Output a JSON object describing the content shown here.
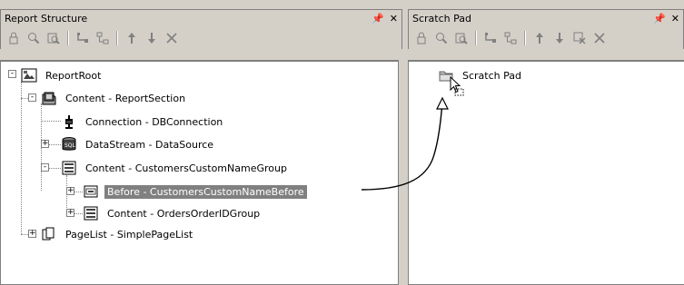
{
  "left_panel": {
    "title": "Report Structure",
    "pin": "†",
    "close": "✕",
    "toolbar": [
      "lock-icon",
      "find-icon",
      "find-replace-icon",
      "indent-icon",
      "outdent-icon",
      "move-up-icon",
      "move-down-icon",
      "delete-icon"
    ],
    "tree": [
      {
        "label": "ReportRoot",
        "expander": "-",
        "icon": "report-root-icon"
      },
      {
        "label": "Content - ReportSection",
        "expander": "-",
        "icon": "section-icon"
      },
      {
        "label": "Connection - DBConnection",
        "expander": "",
        "icon": "connection-icon"
      },
      {
        "label": "DataStream - DataSource",
        "expander": "+",
        "icon": "datasource-icon"
      },
      {
        "label": "Content - CustomersCustomNameGroup",
        "expander": "-",
        "icon": "group-icon"
      },
      {
        "label": "Before - CustomersCustomNameBefore",
        "expander": "+",
        "icon": "band-icon",
        "selected": true
      },
      {
        "label": "Content - OrdersOrderIDGroup",
        "expander": "+",
        "icon": "group-icon"
      },
      {
        "label": "PageList - SimplePageList",
        "expander": "+",
        "icon": "pagelist-icon"
      }
    ]
  },
  "right_panel": {
    "title": "Scratch Pad",
    "pin": "†",
    "close": "✕",
    "toolbar": [
      "lock-icon",
      "find-icon",
      "find-replace-icon",
      "indent-icon",
      "outdent-icon",
      "move-up-icon",
      "move-down-icon",
      "cut-icon",
      "delete-icon"
    ],
    "tree": [
      {
        "label": "Scratch Pad",
        "icon": "folder-icon"
      }
    ]
  }
}
